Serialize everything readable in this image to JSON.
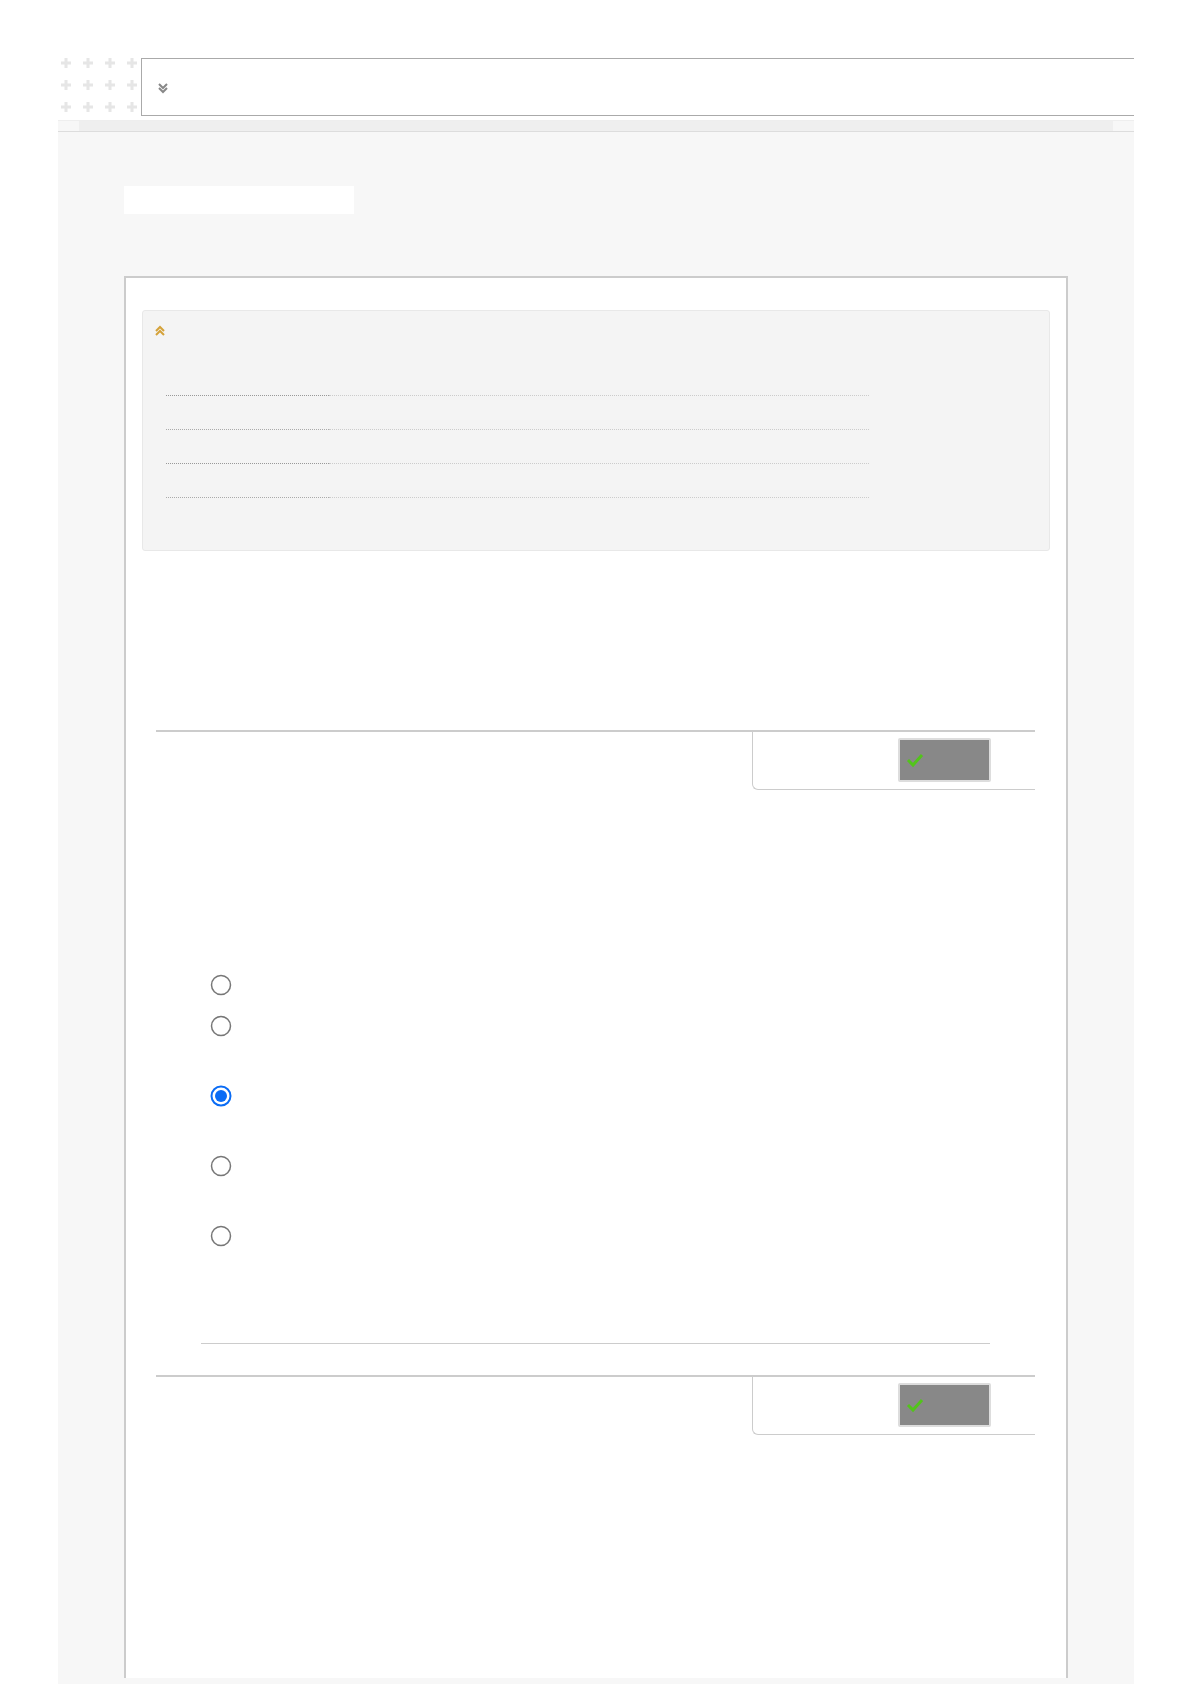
{
  "header": {
    "expanded": false
  },
  "info_panel": {
    "expanded": true
  },
  "questions": [
    {
      "answered": true,
      "options": [
        {
          "selected": false
        },
        {
          "selected": false
        },
        {
          "selected": true
        },
        {
          "selected": false
        },
        {
          "selected": false
        }
      ]
    },
    {
      "answered": true
    }
  ]
}
